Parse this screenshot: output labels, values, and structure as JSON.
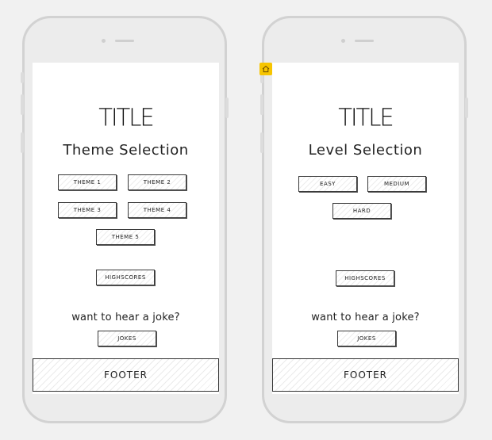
{
  "colors": {
    "background": "#f1f1f1",
    "phone_frame": "#ececec",
    "screen": "#ffffff",
    "badge": "#f7c500"
  },
  "left_screen": {
    "title": "TITLE",
    "subtitle": "Theme Selection",
    "buttons": {
      "theme1": "THEME 1",
      "theme2": "THEME 2",
      "theme3": "THEME 3",
      "theme4": "THEME 4",
      "theme5": "THEME 5"
    },
    "highscores": "HIGHSCORES",
    "joke_prompt": "want to hear a joke?",
    "jokes": "JOKES",
    "footer": "FOOTER"
  },
  "right_screen": {
    "title": "TITLE",
    "subtitle": "Level Selection",
    "buttons": {
      "easy": "EASY",
      "medium": "MEDIUM",
      "hard": "HARD"
    },
    "highscores": "HIGHSCORES",
    "joke_prompt": "want to hear a joke?",
    "jokes": "JOKES",
    "footer": "FOOTER"
  },
  "badge_icon": "home-icon"
}
